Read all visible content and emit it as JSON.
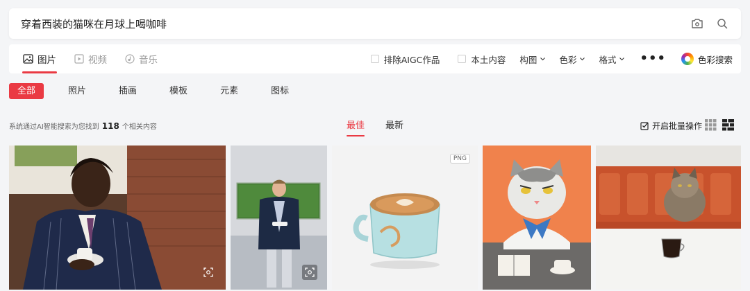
{
  "search": {
    "query": "穿着西装的猫咪在月球上喝咖啡",
    "camera_icon": "camera-icon",
    "search_icon": "search-icon"
  },
  "media_tabs": [
    {
      "label": "图片",
      "icon": "image-icon",
      "active": true
    },
    {
      "label": "视频",
      "icon": "video-icon",
      "active": false
    },
    {
      "label": "音乐",
      "icon": "music-icon",
      "active": false
    }
  ],
  "filters": {
    "exclude_aigc": "排除AIGC作品",
    "local_content": "本土内容",
    "composition": "构图",
    "color": "色彩",
    "format": "格式",
    "more": "•••",
    "color_search": "色彩搜索"
  },
  "categories": [
    {
      "label": "全部",
      "active": true
    },
    {
      "label": "照片",
      "active": false
    },
    {
      "label": "插画",
      "active": false
    },
    {
      "label": "模板",
      "active": false
    },
    {
      "label": "元素",
      "active": false
    },
    {
      "label": "图标",
      "active": false
    }
  ],
  "results": {
    "prefix": "系统通过AI智能搜索为您找到",
    "count": "118",
    "suffix": "个相关内容"
  },
  "sort": {
    "best": "最佳",
    "latest": "最新"
  },
  "batch_label": "开启批量操作",
  "cards": [
    {
      "badge": ""
    },
    {
      "badge": ""
    },
    {
      "badge": "PNG"
    },
    {
      "badge": ""
    },
    {
      "badge": ""
    }
  ],
  "colors": {
    "accent": "#ea3a43",
    "background": "#f4f5f7"
  }
}
